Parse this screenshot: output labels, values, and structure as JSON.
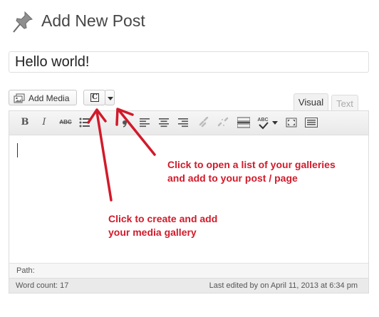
{
  "header": {
    "title": "Add New Post",
    "icon": "pushpin-icon"
  },
  "post": {
    "title_value": "Hello world!"
  },
  "media": {
    "add_media_label": "Add Media",
    "gallery_button_letter": "C"
  },
  "tabs": [
    {
      "label": "Visual",
      "active": true
    },
    {
      "label": "Text",
      "active": false
    }
  ],
  "toolbar": {
    "bold": "B",
    "italic": "I",
    "strikethrough": "ABC",
    "spellcheck": "ABC"
  },
  "path": {
    "label": "Path:"
  },
  "status": {
    "word_count": "Word count: 17",
    "last_edited": "Last edited by on April 11, 2013 at 6:34 pm"
  },
  "annotations": {
    "gallery_list": [
      "Click to open a list of your galleries",
      "and add to your post / page"
    ],
    "create_gallery": [
      "Click to create and add",
      "your media gallery"
    ],
    "color": "#d21a2a"
  }
}
